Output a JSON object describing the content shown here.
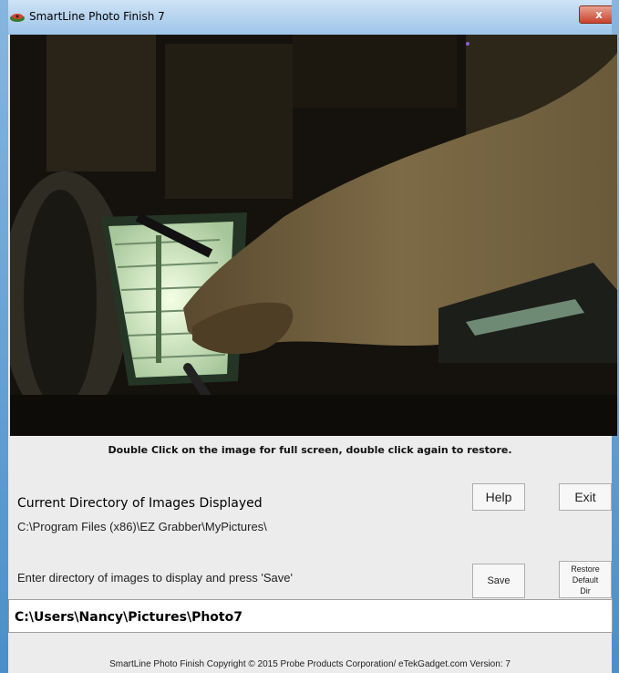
{
  "window": {
    "title": "SmartLine Photo Finish 7",
    "close_label": "x"
  },
  "photo": {
    "description_icon": "photo-preview"
  },
  "hint": "Double Click on the image for full screen, double click again  to restore.",
  "current_dir": {
    "label": "Current Directory of Images Displayed",
    "path": "C:\\Program Files (x86)\\EZ Grabber\\MyPictures\\"
  },
  "buttons": {
    "help": "Help",
    "exit": "Exit",
    "save": "Save",
    "restore_line1": "Restore",
    "restore_line2": "Default",
    "restore_line3": "Dir"
  },
  "enter_dir": {
    "label": "Enter directory of images to display and press 'Save'",
    "value": "C:\\Users\\Nancy\\Pictures\\Photo7"
  },
  "footer": {
    "copyright": "SmartLine Photo Finish Copyright ©  2015 Probe Products Corporation/ eTekGadget.com  Version:  7"
  },
  "colors": {
    "titlebar": "#b5d5f1",
    "close": "#c9422b",
    "background": "#ececec"
  }
}
